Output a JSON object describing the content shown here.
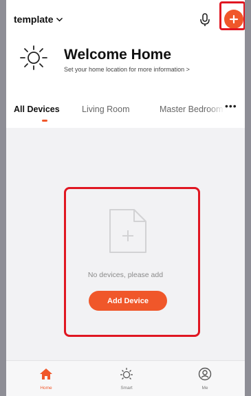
{
  "header": {
    "home_name": "template",
    "icons": {
      "dropdown": "chevron-down-icon",
      "mic": "microphone-icon",
      "add": "plus-circle-icon"
    }
  },
  "welcome": {
    "title": "Welcome Home",
    "subtitle": "Set your home location for more information >",
    "icon": "sun-icon"
  },
  "tabs": [
    {
      "label": "All Devices",
      "active": true
    },
    {
      "label": "Living Room",
      "active": false
    },
    {
      "label": "Master Bedroom",
      "active": false
    }
  ],
  "tabs_more": "•••",
  "empty_state": {
    "message": "No devices, please add",
    "button_label": "Add Device",
    "icon": "add-document-icon"
  },
  "bottom_nav": [
    {
      "label": "Home",
      "icon": "home-icon",
      "active": true
    },
    {
      "label": "Smart",
      "icon": "sun-icon",
      "active": false
    },
    {
      "label": "Me",
      "icon": "user-icon",
      "active": false
    }
  ],
  "colors": {
    "accent": "#f0572a",
    "highlight": "#e01621",
    "background": "#f2f2f4",
    "text": "#111111",
    "muted": "#8a8a8a"
  }
}
